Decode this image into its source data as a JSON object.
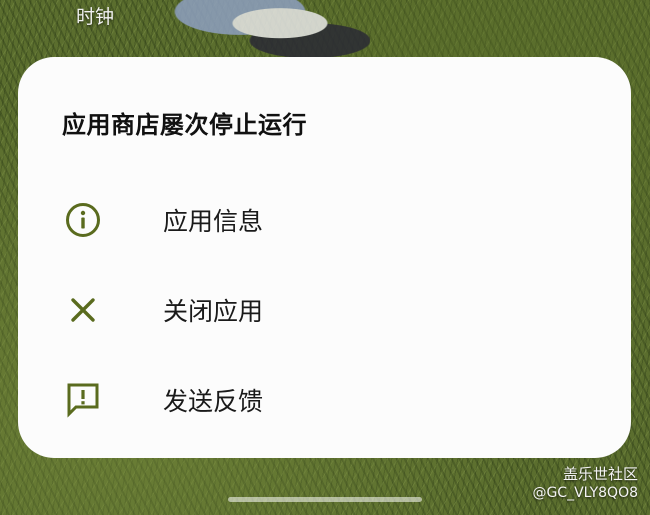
{
  "background": {
    "app_label": "时钟"
  },
  "dialog": {
    "title": "应用商店屡次停止运行",
    "items": [
      {
        "label": "应用信息",
        "icon": "info-icon"
      },
      {
        "label": "关闭应用",
        "icon": "close-icon"
      },
      {
        "label": "发送反馈",
        "icon": "feedback-icon"
      }
    ]
  },
  "watermark": {
    "line1": "盖乐世社区",
    "line2": "@GC_VLY8QO8"
  },
  "colors": {
    "icon_accent": "#5a6b1e",
    "dialog_bg": "#fcfcfc",
    "title_text": "#111111"
  }
}
